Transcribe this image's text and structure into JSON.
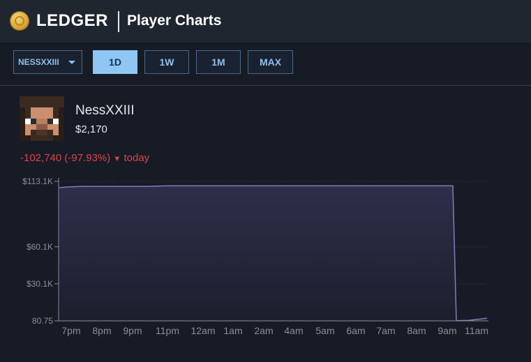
{
  "header": {
    "brand": "LEDGER",
    "title": "Player Charts",
    "logo_icon": "coin-icon"
  },
  "controls": {
    "player_select": "NESSXXIII",
    "ranges": [
      "1D",
      "1W",
      "1M",
      "MAX"
    ],
    "active_range": "1D"
  },
  "player": {
    "name": "NessXXIII",
    "value": "$2,170",
    "change": "-102,740 (-97.93%)",
    "change_suffix": "today",
    "avatar_icon": "player-avatar-icon"
  },
  "colors": {
    "accent": "#8fc6f3",
    "negative": "#e0434e",
    "line": "#7e7fb8"
  },
  "chart_data": {
    "type": "area",
    "x": [
      "7pm",
      "8pm",
      "9pm",
      "11pm",
      "12am",
      "1am",
      "2am",
      "4am",
      "5am",
      "6am",
      "7am",
      "8am",
      "9am",
      "11am"
    ],
    "x_tick_labels": [
      "7pm",
      "8pm",
      "9pm",
      "11pm",
      "12am",
      "1am",
      "2am",
      "4am",
      "5am",
      "6am",
      "7am",
      "8am",
      "9am",
      "11am"
    ],
    "y_tick_labels": [
      "$113.1K",
      "$60.1K",
      "$30.1K",
      "80.75"
    ],
    "y_ticks": [
      113100,
      60100,
      30100,
      80.75
    ],
    "series": [
      {
        "points": [
          [
            "7pm",
            108000
          ],
          [
            "7pm+",
            108500
          ],
          [
            "8pm",
            109000
          ],
          [
            "9pm",
            109000
          ],
          [
            "11pm",
            109500
          ],
          [
            "12am",
            109500
          ],
          [
            "1am",
            109500
          ],
          [
            "2am",
            109500
          ],
          [
            "4am",
            109500
          ],
          [
            "5am",
            109500
          ],
          [
            "6am",
            109500
          ],
          [
            "7am",
            109500
          ],
          [
            "8am",
            109500
          ],
          [
            "9am-",
            109500
          ],
          [
            "9am",
            200
          ],
          [
            "9am+",
            500
          ],
          [
            "11am",
            2170
          ]
        ]
      }
    ],
    "ylim": [
      80.75,
      113100
    ],
    "grid": true
  }
}
